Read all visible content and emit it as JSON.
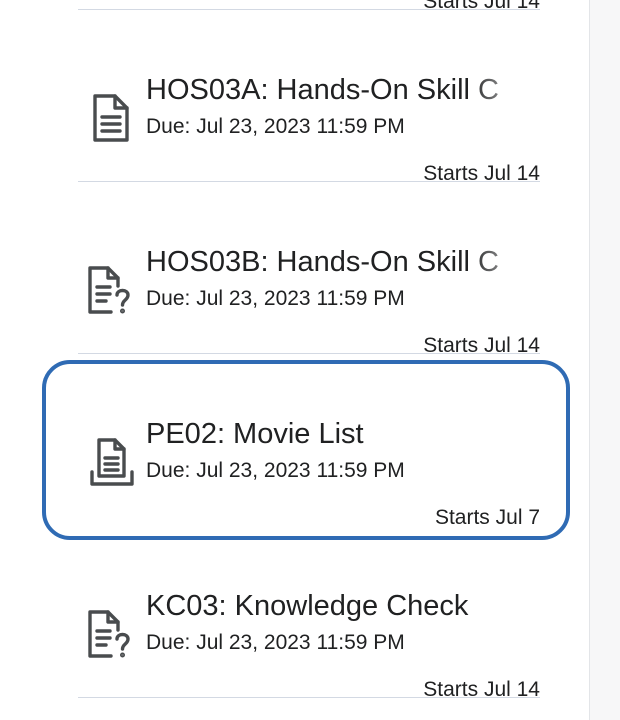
{
  "items": [
    {
      "title": "",
      "due": "",
      "starts": "Starts Jul 14",
      "icon": "assignment-icon"
    },
    {
      "title": "HOS03A: Hands-On Skill C",
      "due": "Due: Jul 23, 2023 11:59 PM",
      "starts": "Starts Jul 14",
      "icon": "assignment-icon"
    },
    {
      "title": "HOS03B: Hands-On Skill C",
      "due": "Due: Jul 23, 2023 11:59 PM",
      "starts": "Starts Jul 14",
      "icon": "quiz-icon"
    },
    {
      "title": "PE02: Movie List",
      "due": "Due: Jul 23, 2023 11:59 PM",
      "starts": "Starts Jul 7",
      "icon": "submission-icon",
      "focused": true
    },
    {
      "title": "KC03: Knowledge Check",
      "due": "Due: Jul 23, 2023 11:59 PM",
      "starts": "Starts Jul 14",
      "icon": "quiz-icon"
    }
  ],
  "colors": {
    "focus_ring": "#2f6bb4",
    "divider": "#d3d9e3",
    "text": "#202122",
    "icon": "#494c4e"
  }
}
